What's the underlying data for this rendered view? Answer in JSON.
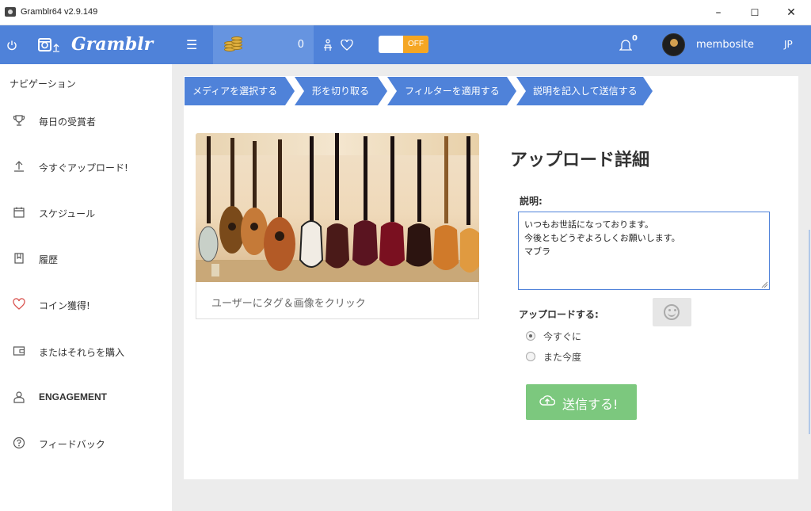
{
  "window": {
    "title": "Gramblr64 v2.9.149",
    "minimize": "–",
    "maximize": "☐",
    "close": "✕"
  },
  "topbar": {
    "power_icon": "power-icon",
    "brand": "Gramblr",
    "menu_icon": "☰",
    "coins": "0",
    "notifications_count": "0",
    "toggle_label": "OFF",
    "username": "membosite",
    "language": "JP",
    "accent": "#4f82d9"
  },
  "sidebar": {
    "heading": "ナビゲーション",
    "items": [
      {
        "label": "毎日の受賞者",
        "icon": "trophy-icon",
        "glyph": "🏆"
      },
      {
        "label": "今すぐアップロード!",
        "icon": "upload-icon",
        "glyph": "⭱"
      },
      {
        "label": "スケジュール",
        "icon": "calendar-icon",
        "glyph": "📅"
      },
      {
        "label": "履歴",
        "icon": "bookmark-icon",
        "glyph": "🔖"
      },
      {
        "label": "コイン獲得!",
        "icon": "heart-icon",
        "glyph": "♡"
      },
      {
        "label": "またはそれらを購入",
        "icon": "wallet-icon",
        "glyph": "👛"
      },
      {
        "label": "ENGAGEMENT",
        "icon": "user-icon",
        "glyph": "👤"
      },
      {
        "label": "フィードバック",
        "icon": "help-icon",
        "glyph": "?"
      }
    ]
  },
  "steps": [
    "メディアを選択する",
    "形を切り取る",
    "フィルターを適用する",
    "説明を記入して送信する"
  ],
  "media": {
    "caption_placeholder": "ユーザーにタグ＆画像をクリック"
  },
  "details": {
    "heading": "アップロード詳細",
    "description_label": "説明:",
    "description_lines": [
      "いつもお世話になっております。",
      "今後ともどうぞよろしくお願いします。",
      "マブラ"
    ],
    "upload_label": "アップロードする:",
    "radio_now": "今すぐに",
    "radio_later": "また今度",
    "submit_label": "送信する!"
  }
}
